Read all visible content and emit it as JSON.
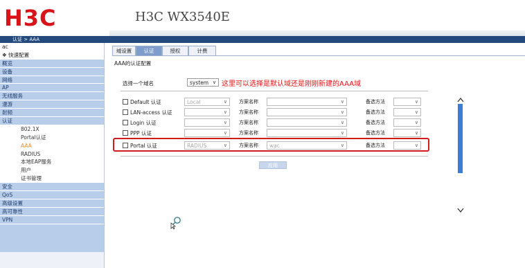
{
  "header": {
    "logo_text": "H3C",
    "product": "H3C WX3540E"
  },
  "breadcrumb": "认证 > AAA",
  "sidebar": {
    "root": "ac",
    "quick": "❖ 快速配置",
    "items": [
      {
        "label": "概览",
        "type": "group"
      },
      {
        "label": "设备",
        "type": "group"
      },
      {
        "label": "网络",
        "type": "group"
      },
      {
        "label": "AP",
        "type": "group"
      },
      {
        "label": "无线服务",
        "type": "group"
      },
      {
        "label": "漫游",
        "type": "group"
      },
      {
        "label": "射频",
        "type": "group"
      },
      {
        "label": "认证",
        "type": "group"
      },
      {
        "label": "802.1X",
        "type": "sub"
      },
      {
        "label": "Portal认证",
        "type": "sub"
      },
      {
        "label": "AAA",
        "type": "sub-active"
      },
      {
        "label": "RADIUS",
        "type": "sub"
      },
      {
        "label": "本地EAP服务",
        "type": "sub"
      },
      {
        "label": "用户",
        "type": "sub"
      },
      {
        "label": "证书管理",
        "type": "sub"
      },
      {
        "label": "安全",
        "type": "group"
      },
      {
        "label": "QoS",
        "type": "group"
      },
      {
        "label": "高级设置",
        "type": "group"
      },
      {
        "label": "高可靠性",
        "type": "group"
      },
      {
        "label": "VPN",
        "type": "group"
      }
    ]
  },
  "tabs": [
    "域设置",
    "认证",
    "授权",
    "计费"
  ],
  "active_tab": "认证",
  "section_title": "AAA的认证配置",
  "domain": {
    "label": "选择一个域名",
    "value": "system"
  },
  "annotation": "这里可以选择是默认域还是刚刚新建的AAA域",
  "auth_rows": [
    {
      "label": "Default 认证",
      "mode": "Local",
      "scheme_label": "方案名称",
      "scheme": "",
      "backup_label": "备选方法",
      "backup": ""
    },
    {
      "label": "LAN-access 认证",
      "mode": "",
      "scheme_label": "方案名称",
      "scheme": "",
      "backup_label": "备选方法",
      "backup": ""
    },
    {
      "label": "Login 认证",
      "mode": "",
      "scheme_label": "方案名称",
      "scheme": "",
      "backup_label": "备选方法",
      "backup": ""
    },
    {
      "label": "PPP 认证",
      "mode": "",
      "scheme_label": "方案名称",
      "scheme": "",
      "backup_label": "备选方法",
      "backup": ""
    },
    {
      "label": "Portal 认证",
      "mode": "RADIUS",
      "scheme_label": "方案名称",
      "scheme": "wac",
      "backup_label": "备选方法",
      "backup": ""
    }
  ],
  "apply_label": "应用",
  "dropdown_arrow": "∨",
  "colors": {
    "brand_red": "#d8141a",
    "nav_blue": "#23497d",
    "highlight_red": "#d31b1b",
    "note_red": "#ee1111"
  }
}
